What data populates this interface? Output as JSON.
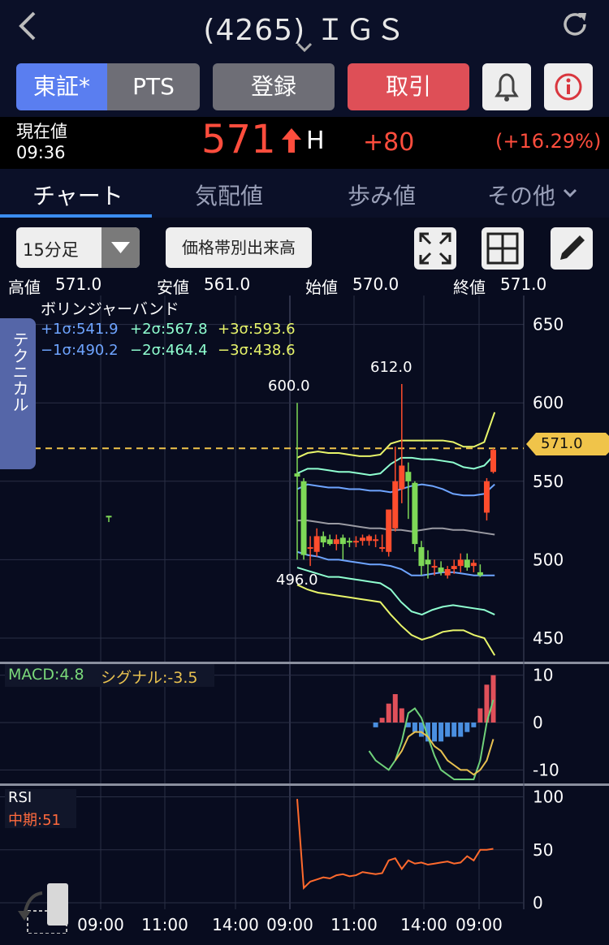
{
  "header": {
    "title": "(4265) ＩＧＳ"
  },
  "buttons": {
    "tse": "東証*",
    "pts": "PTS",
    "register": "登録",
    "trade": "取引"
  },
  "price": {
    "label": "現在値",
    "time": "09:36",
    "value": "571",
    "flag": "H",
    "change": "+80",
    "change_pct": "(+16.29%)"
  },
  "tabs": [
    "チャート",
    "気配値",
    "歩み値",
    "その他"
  ],
  "toolbar": {
    "interval": "15分足",
    "volume_profile": "価格帯別出来高"
  },
  "ohlc": {
    "high_label": "高値",
    "high": "571.0",
    "low_label": "安値",
    "low": "561.0",
    "open_label": "始値",
    "open": "570.0",
    "close_label": "終値",
    "close": "571.0"
  },
  "side_tab": "テクニカル",
  "bollinger": {
    "title": "ボリンジャーバンド",
    "p1": "+1σ:541.9",
    "p2": "+2σ:567.8",
    "p3": "+3σ:593.6",
    "m1": "−1σ:490.2",
    "m2": "−2σ:464.4",
    "m3": "−3σ:438.6"
  },
  "annotations": {
    "a600": "600.0",
    "a612": "612.0",
    "a496": "496.0",
    "current": "571.0"
  },
  "macd": {
    "label": "MACD:4.8",
    "signal": "シグナル:-3.5"
  },
  "rsi": {
    "label": "RSI",
    "mid": "中期:51"
  },
  "chart_data": {
    "type": "candlestick",
    "price_axis": {
      "ticks": [
        650,
        600,
        550,
        500,
        450
      ],
      "ylim": [
        435,
        656
      ]
    },
    "macd_axis": {
      "ticks": [
        10,
        0,
        -10
      ],
      "ylim": [
        -12,
        12
      ]
    },
    "rsi_axis": {
      "ticks": [
        100,
        50,
        0
      ],
      "ylim": [
        0,
        105
      ]
    },
    "x_ticks": [
      "09:00",
      "11:00",
      "14:00",
      "09:00",
      "11:00",
      "14:00",
      "09:00"
    ],
    "current_price": 571.0,
    "candles": [
      {
        "i": 0,
        "o": 528,
        "h": 528,
        "l": 524,
        "c": 527
      },
      {
        "i": 1,
        "o": 555,
        "h": 600,
        "l": 500,
        "c": 553
      },
      {
        "i": 2,
        "o": 550,
        "h": 552,
        "l": 500,
        "c": 503
      },
      {
        "i": 3,
        "o": 508,
        "h": 515,
        "l": 496,
        "c": 508
      },
      {
        "i": 4,
        "o": 505,
        "h": 520,
        "l": 502,
        "c": 515
      },
      {
        "i": 5,
        "o": 515,
        "h": 518,
        "l": 508,
        "c": 511
      },
      {
        "i": 6,
        "o": 513,
        "h": 516,
        "l": 509,
        "c": 510
      },
      {
        "i": 7,
        "o": 510,
        "h": 516,
        "l": 506,
        "c": 513
      },
      {
        "i": 8,
        "o": 514,
        "h": 516,
        "l": 500,
        "c": 510
      },
      {
        "i": 9,
        "o": 512,
        "h": 514,
        "l": 508,
        "c": 511
      },
      {
        "i": 10,
        "o": 511,
        "h": 515,
        "l": 508,
        "c": 512
      },
      {
        "i": 11,
        "o": 512,
        "h": 516,
        "l": 509,
        "c": 514
      },
      {
        "i": 12,
        "o": 512,
        "h": 516,
        "l": 509,
        "c": 515
      },
      {
        "i": 13,
        "o": 512,
        "h": 516,
        "l": 508,
        "c": 513
      },
      {
        "i": 14,
        "o": 508,
        "h": 516,
        "l": 505,
        "c": 508
      },
      {
        "i": 15,
        "o": 505,
        "h": 531,
        "l": 502,
        "c": 532
      },
      {
        "i": 16,
        "o": 520,
        "h": 572,
        "l": 518,
        "c": 550
      },
      {
        "i": 17,
        "o": 545,
        "h": 612,
        "l": 536,
        "c": 560
      },
      {
        "i": 18,
        "o": 556,
        "h": 562,
        "l": 526,
        "c": 550
      },
      {
        "i": 19,
        "o": 549,
        "h": 550,
        "l": 505,
        "c": 510
      },
      {
        "i": 20,
        "o": 508,
        "h": 512,
        "l": 490,
        "c": 496
      },
      {
        "i": 21,
        "o": 500,
        "h": 506,
        "l": 488,
        "c": 497
      },
      {
        "i": 22,
        "o": 496,
        "h": 500,
        "l": 490,
        "c": 496
      },
      {
        "i": 23,
        "o": 495,
        "h": 499,
        "l": 490,
        "c": 492
      },
      {
        "i": 24,
        "o": 490,
        "h": 496,
        "l": 488,
        "c": 494
      },
      {
        "i": 25,
        "o": 494,
        "h": 500,
        "l": 491,
        "c": 496
      },
      {
        "i": 26,
        "o": 496,
        "h": 504,
        "l": 492,
        "c": 500
      },
      {
        "i": 27,
        "o": 500,
        "h": 504,
        "l": 493,
        "c": 495
      },
      {
        "i": 28,
        "o": 496,
        "h": 500,
        "l": 492,
        "c": 498
      },
      {
        "i": 29,
        "o": 492,
        "h": 497,
        "l": 489,
        "c": 490
      },
      {
        "i": 30,
        "o": 530,
        "h": 552,
        "l": 525,
        "c": 550
      },
      {
        "i": 31,
        "o": 556,
        "h": 571,
        "l": 555,
        "c": 570
      }
    ],
    "bands": {
      "mid": [
        525,
        525,
        524,
        523,
        523,
        522,
        521,
        520,
        520,
        519,
        519,
        518,
        519,
        520,
        520,
        519,
        519,
        518,
        517,
        516
      ],
      "p1": [
        545,
        548,
        547,
        546,
        546,
        545,
        545,
        544,
        544,
        543,
        545,
        547,
        548,
        547,
        545,
        542,
        541,
        541,
        542,
        548
      ],
      "m1": [
        505,
        503,
        502,
        500,
        500,
        499,
        498,
        497,
        497,
        496,
        494,
        490,
        490,
        491,
        492,
        492,
        491,
        490,
        490,
        490
      ],
      "p2": [
        555,
        558,
        558,
        557,
        556,
        556,
        555,
        554,
        555,
        561,
        565,
        565,
        564,
        564,
        563,
        562,
        559,
        558,
        560,
        567
      ],
      "m2": [
        495,
        493,
        491,
        489,
        489,
        488,
        487,
        486,
        485,
        481,
        473,
        467,
        465,
        468,
        470,
        471,
        470,
        469,
        468,
        465
      ],
      "p3": [
        565,
        568,
        569,
        568,
        568,
        567,
        566,
        566,
        567,
        574,
        576,
        576,
        576,
        576,
        576,
        575,
        572,
        572,
        575,
        594
      ],
      "m3": [
        484,
        481,
        479,
        478,
        477,
        476,
        475,
        474,
        473,
        465,
        458,
        452,
        449,
        451,
        454,
        455,
        455,
        452,
        450,
        439
      ]
    },
    "macd_hist": [
      0,
      0,
      0,
      0,
      0,
      0,
      0,
      0,
      0,
      0,
      0,
      0,
      0,
      -1,
      1,
      4,
      6,
      3,
      -1,
      -2,
      -3,
      -4,
      -4,
      -4,
      -3,
      -3,
      -3,
      -2,
      -1,
      3,
      8,
      10
    ],
    "macd_line": [
      null,
      null,
      null,
      null,
      null,
      null,
      null,
      null,
      null,
      null,
      null,
      null,
      -6,
      -8,
      -9,
      -10,
      -8,
      -4,
      2,
      3,
      1,
      -3,
      -7,
      -10,
      -11,
      -12,
      -12,
      -12,
      -12,
      -8,
      0,
      4.8
    ],
    "signal_line": [
      null,
      null,
      null,
      null,
      null,
      null,
      null,
      null,
      null,
      null,
      null,
      null,
      null,
      null,
      null,
      null,
      -8,
      -6,
      -3,
      -2,
      -2,
      -3,
      -5,
      -6,
      -8,
      -9,
      -10,
      -10,
      -11,
      -10,
      -8,
      -3.5
    ],
    "rsi": [
      null,
      98,
      14,
      20,
      22,
      24,
      23,
      26,
      27,
      25,
      26,
      29,
      28,
      27,
      28,
      40,
      42,
      32,
      40,
      37,
      38,
      36,
      37,
      38,
      39,
      37,
      38,
      44,
      40,
      50,
      50,
      51
    ]
  }
}
